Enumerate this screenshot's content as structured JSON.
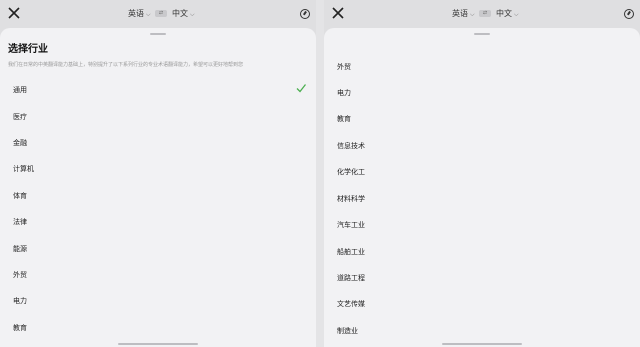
{
  "colors": {
    "check": "#4caf50",
    "sheet": "#f2f2f4",
    "background": "#dfdfe1"
  },
  "left": {
    "header": {
      "source_lang": "英语",
      "target_lang": "中文",
      "swap_label": "⇄"
    },
    "sheet": {
      "title": "选择行业",
      "description": "我们在日常的中英翻译能力基础上，特别提升了以下系列行业的专业术语翻译能力，希望可以更好地帮到您",
      "items": [
        {
          "label": "通用",
          "selected": true
        },
        {
          "label": "医疗",
          "selected": false
        },
        {
          "label": "金融",
          "selected": false
        },
        {
          "label": "计算机",
          "selected": false
        },
        {
          "label": "体育",
          "selected": false
        },
        {
          "label": "法律",
          "selected": false
        },
        {
          "label": "能源",
          "selected": false
        },
        {
          "label": "外贸",
          "selected": false
        },
        {
          "label": "电力",
          "selected": false
        },
        {
          "label": "教育",
          "selected": false
        }
      ]
    }
  },
  "right": {
    "header": {
      "source_lang": "英语",
      "target_lang": "中文",
      "swap_label": "⇄"
    },
    "sheet": {
      "items": [
        {
          "label": "外贸"
        },
        {
          "label": "电力"
        },
        {
          "label": "教育"
        },
        {
          "label": "信息技术"
        },
        {
          "label": "化学化工"
        },
        {
          "label": "材料科学"
        },
        {
          "label": "汽车工业"
        },
        {
          "label": "船舶工业"
        },
        {
          "label": "道路工程"
        },
        {
          "label": "文艺传媒"
        },
        {
          "label": "制造业"
        }
      ]
    }
  }
}
